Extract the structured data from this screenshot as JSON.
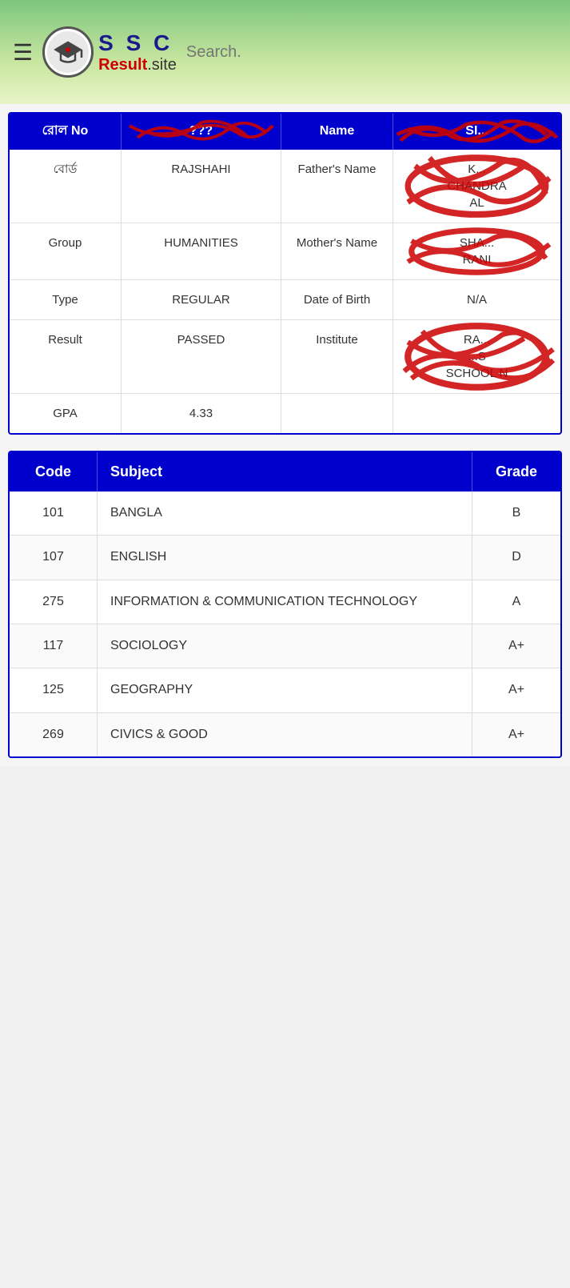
{
  "header": {
    "menu_icon": "☰",
    "logo_icon": "🎓",
    "logo_ssc": "S  S  C",
    "logo_result": "Result",
    "logo_site": ".site",
    "search_placeholder": "Search."
  },
  "info_table": {
    "headers": [
      "রোল No",
      "???",
      "Name",
      "SI... / Pa..."
    ],
    "rows": [
      {
        "col1": "বোর্ড",
        "col2": "RAJSHAHI",
        "col3": "Father's Name",
        "col4": "K...\nCHANDRA\nAL",
        "col4_scribbled": true
      },
      {
        "col1": "Group",
        "col2": "HUMANITIES",
        "col3": "Mother's Name",
        "col4": "SHA...\nRANI",
        "col4_scribbled": true
      },
      {
        "col1": "Type",
        "col2": "REGULAR",
        "col3": "Date of Birth",
        "col4": "N/A",
        "col4_scribbled": false
      },
      {
        "col1": "Result",
        "col2": "PASSED",
        "col3": "Institute",
        "col4": "RA...\n...S\nSCHOOL N",
        "col4_scribbled": true
      },
      {
        "col1": "GPA",
        "col2": "4.33",
        "col3": "",
        "col4": "",
        "col4_scribbled": false
      }
    ]
  },
  "subject_table": {
    "headers": [
      "Code",
      "Subject",
      "Grade"
    ],
    "rows": [
      {
        "code": "101",
        "subject": "BANGLA",
        "grade": "B"
      },
      {
        "code": "107",
        "subject": "ENGLISH",
        "grade": "D"
      },
      {
        "code": "275",
        "subject": "INFORMATION & COMMUNICATION TECHNOLOGY",
        "grade": "A"
      },
      {
        "code": "117",
        "subject": "SOCIOLOGY",
        "grade": "A+"
      },
      {
        "code": "125",
        "subject": "GEOGRAPHY",
        "grade": "A+"
      },
      {
        "code": "269",
        "subject": "CIVICS & GOOD",
        "grade": "A+"
      }
    ]
  }
}
